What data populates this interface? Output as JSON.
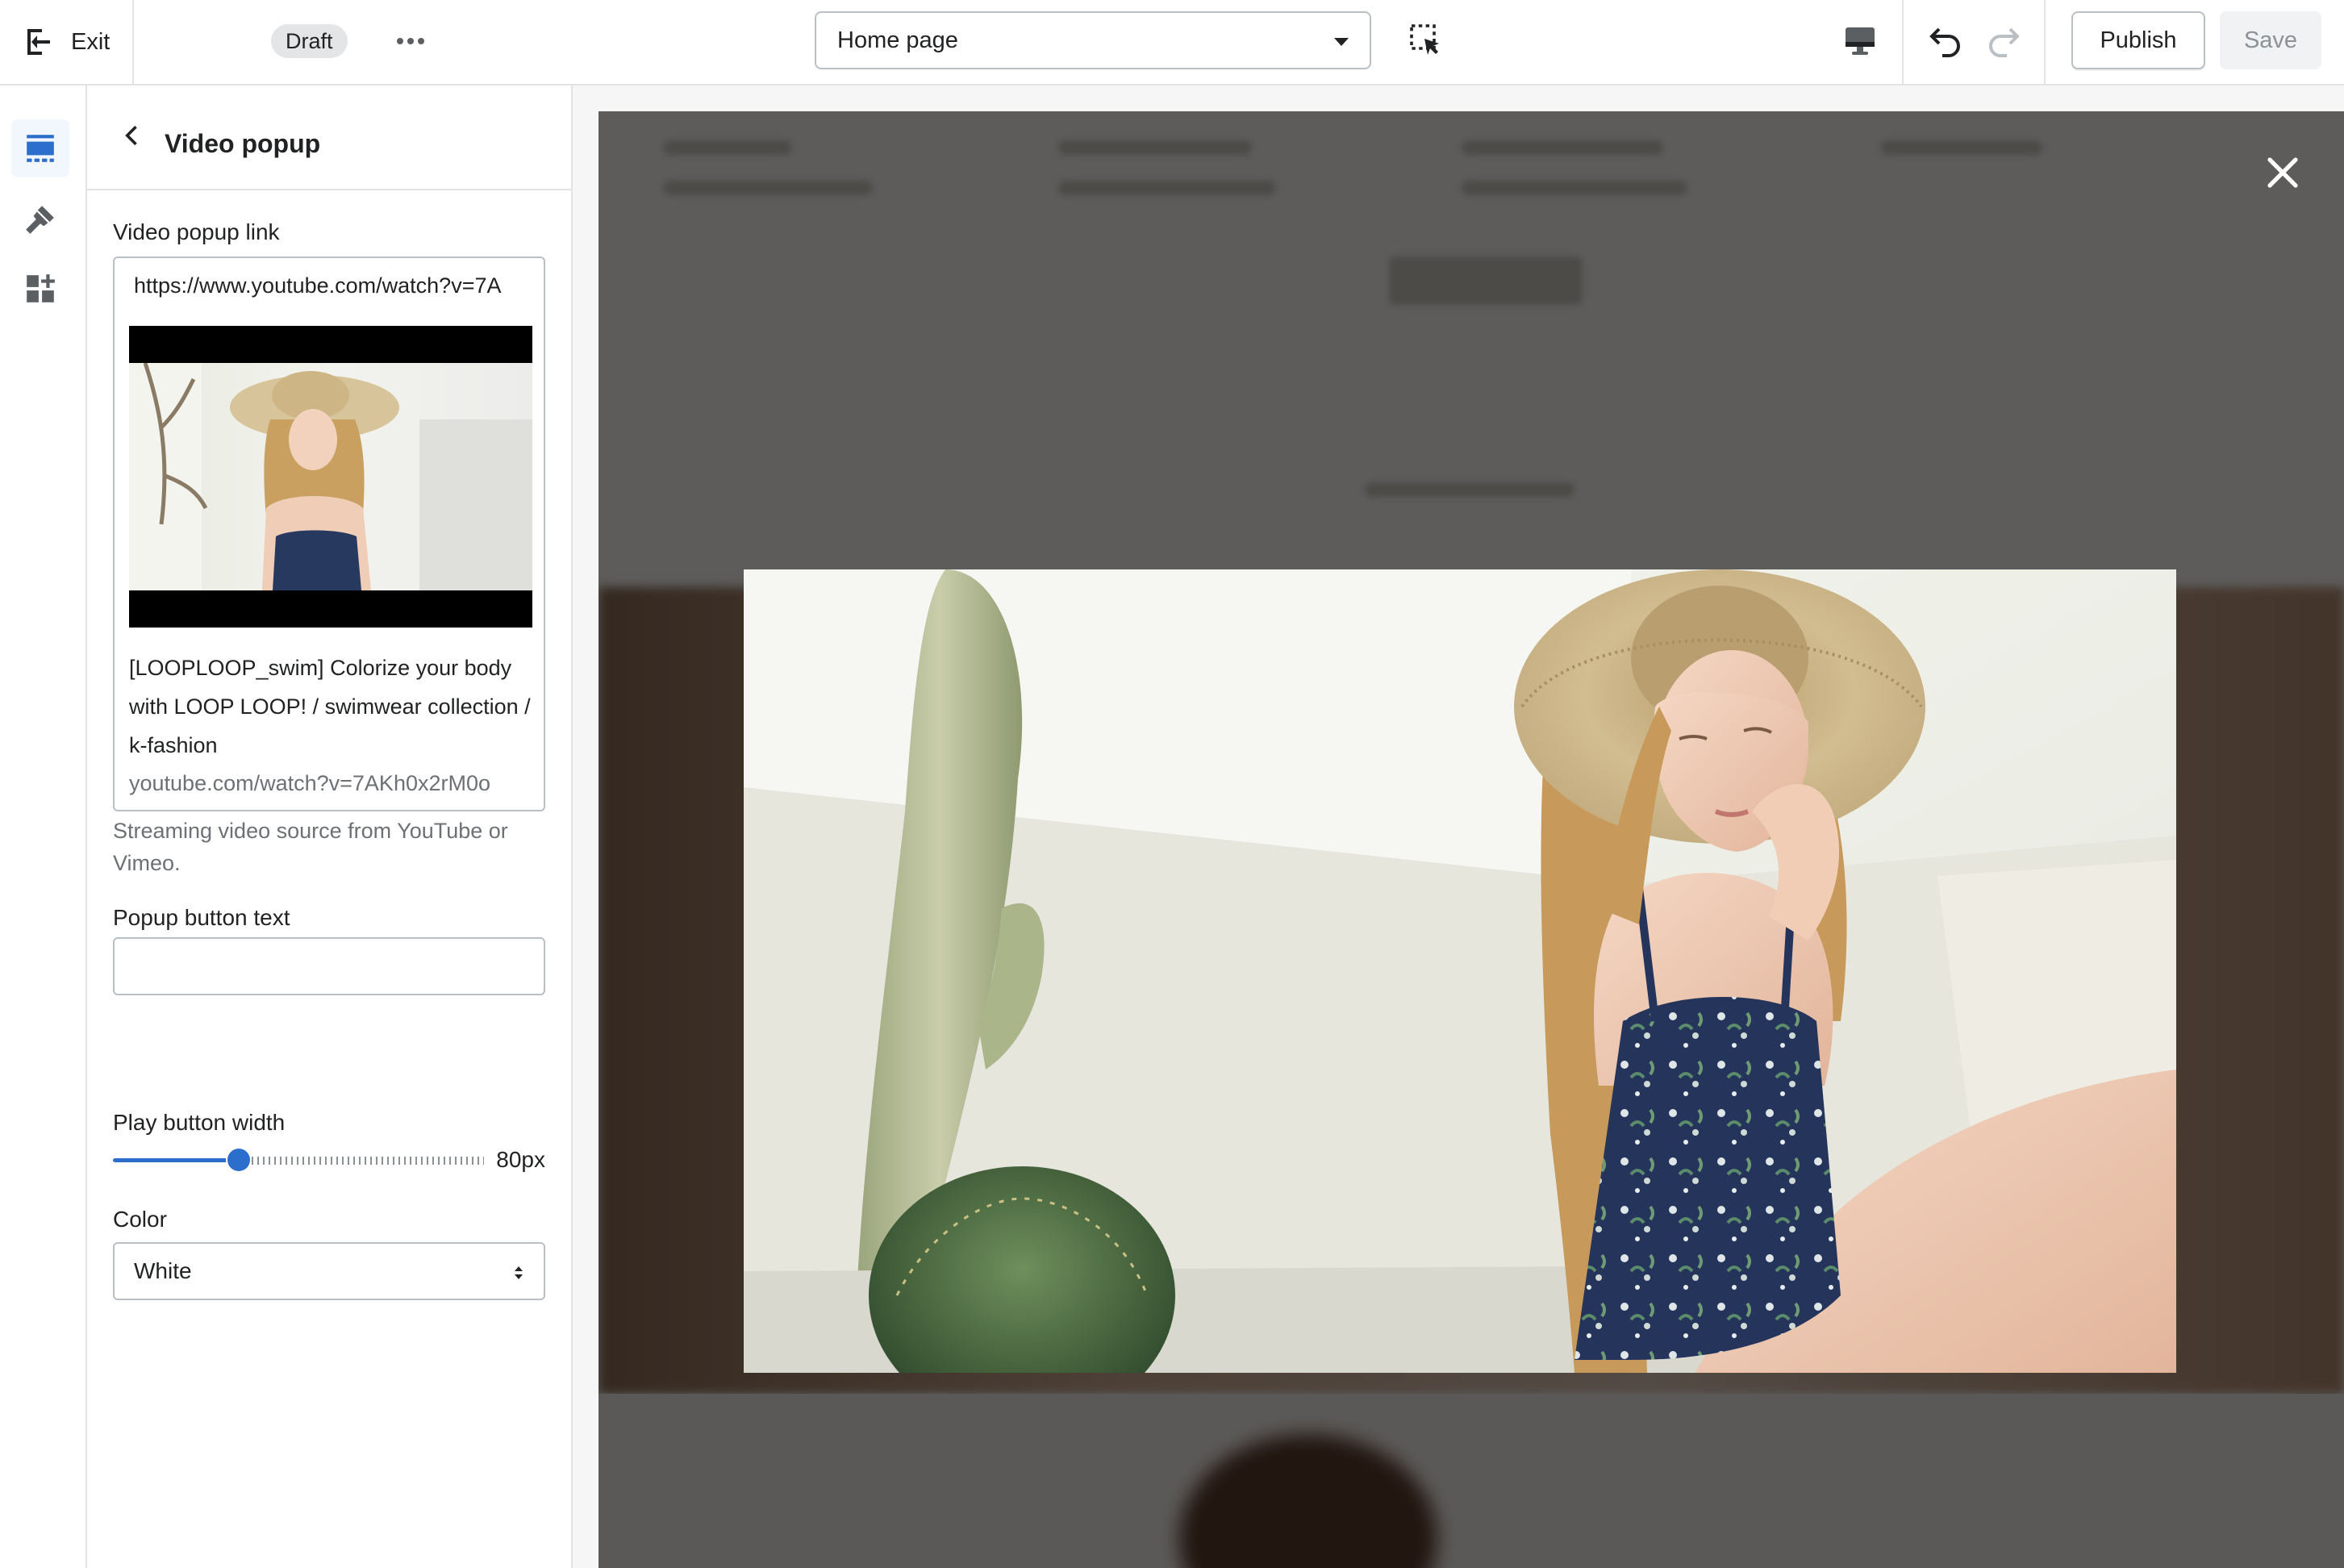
{
  "topbar": {
    "exit_label": "Exit",
    "status_badge": "Draft",
    "template_select": "Home page",
    "publish_label": "Publish",
    "save_label": "Save"
  },
  "icons": {
    "exit": "exit-icon",
    "more": "more-horizontal-icon",
    "inspect": "select-inspector-icon",
    "desktop": "desktop-icon",
    "undo": "undo-icon",
    "redo": "redo-icon",
    "sections": "sections-icon",
    "theme_settings": "paint-brush-icon",
    "apps": "apps-icon",
    "back": "chevron-left-icon",
    "close": "close-icon"
  },
  "panel": {
    "title": "Video popup",
    "video_link": {
      "label": "Video popup link",
      "value": "https://www.youtube.com/watch?v=7A",
      "preview_title": "[LOOPLOOP_swim] Colorize your body with LOOP LOOP! / swimwear collection / k-fashion",
      "preview_url": "youtube.com/watch?v=7AKh0x2rM0o",
      "help": "Streaming video source from YouTube or Vimeo."
    },
    "popup_button_text": {
      "label": "Popup button text",
      "value": ""
    },
    "play_button_width": {
      "label": "Play button width",
      "value_display": "80px",
      "fraction": 0.34
    },
    "color": {
      "label": "Color",
      "selected": "White"
    }
  },
  "colors": {
    "accent": "#2c6ecb",
    "border": "#babfc3",
    "subdued_text": "#6d7175",
    "overlay": "rgba(0,0,0,0.62)"
  }
}
